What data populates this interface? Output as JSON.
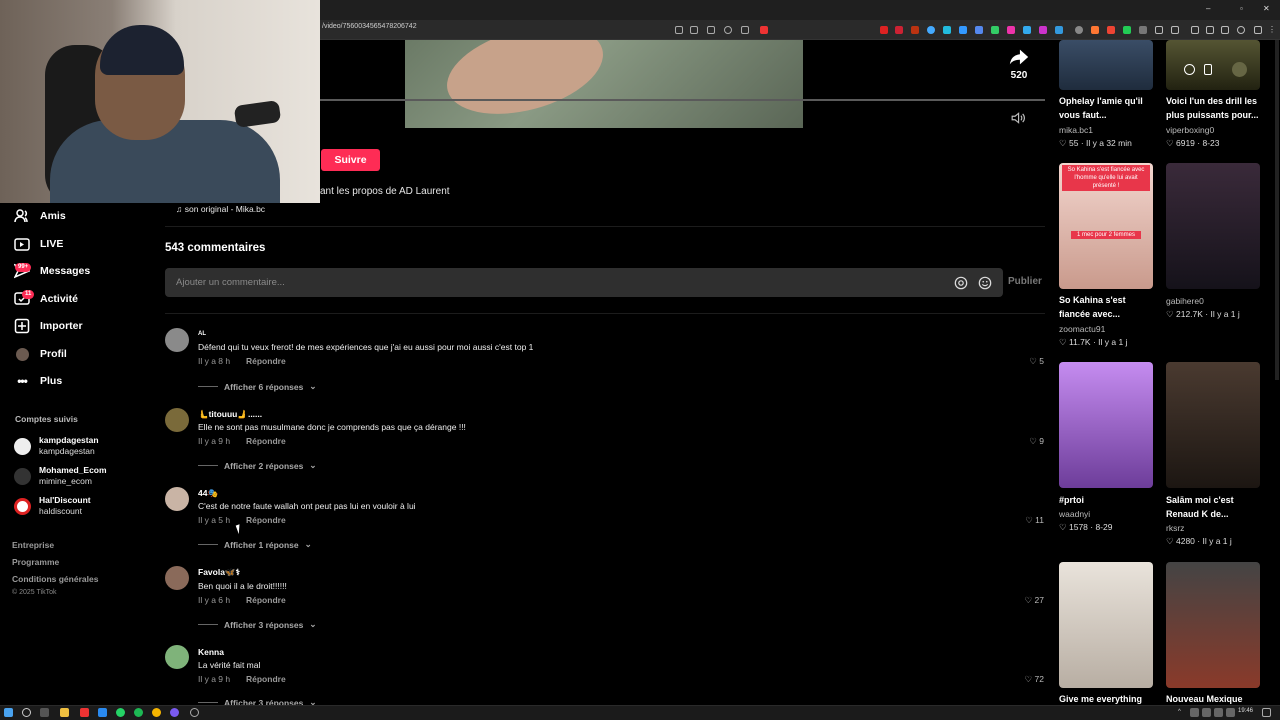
{
  "browser": {
    "url": "/video/7560034565478206742",
    "window_controls": [
      "–",
      "▫",
      "✕"
    ]
  },
  "video": {
    "share_count": "520"
  },
  "follow_label": "Suivre",
  "description_tail": "ant les propos de AD Laurent",
  "sound": "son original - Mika.bc",
  "sidebar": {
    "items": [
      {
        "label": "Amis",
        "icon": "friends-icon"
      },
      {
        "label": "LIVE",
        "icon": "live-icon"
      },
      {
        "label": "Messages",
        "icon": "messages-icon",
        "badge": "99+"
      },
      {
        "label": "Activité",
        "icon": "activity-icon",
        "badge": "11"
      },
      {
        "label": "Importer",
        "icon": "upload-icon"
      },
      {
        "label": "Profil",
        "icon": "profile-icon"
      },
      {
        "label": "Plus",
        "icon": "more-icon"
      }
    ],
    "followed_heading": "Comptes suivis",
    "followed": [
      {
        "name": "kampdagestan",
        "handle": "kampdagestan"
      },
      {
        "name": "Mohamed_Ecom",
        "handle": "mimine_ecom"
      },
      {
        "name": "Hal'Discount",
        "handle": "haldiscount"
      }
    ],
    "footer_links": [
      "Entreprise",
      "Programme",
      "Conditions générales"
    ],
    "copyright": "© 2025 TikTok"
  },
  "comments": {
    "count_label": "543 commentaires",
    "input_placeholder": "Ajouter un commentaire...",
    "post_label": "Publier",
    "reply_label": "Répondre",
    "items": [
      {
        "user": "AL",
        "text": "Défend qui tu veux frerot! de mes expériences que j'ai eu aussi pour moi aussi c'est top 1",
        "time": "Il y a 8 h",
        "likes": "5",
        "more": "Afficher 6 réponses"
      },
      {
        "user": "🫷titouuu🫸......",
        "text": "Elle ne sont pas musulmane donc je comprends pas que ça dérange !!!",
        "time": "Il y a 9 h",
        "likes": "9",
        "more": "Afficher 2 réponses"
      },
      {
        "user": "44🎭",
        "text": "C'est de notre faute wallah ont peut pas lui en vouloir à lui",
        "time": "Il y a 5 h",
        "likes": "11",
        "more": "Afficher 1 réponse"
      },
      {
        "user": "Favola🦋⚕",
        "text": "Ben quoi il a le droit!!!!!!",
        "time": "Il y a 6 h",
        "likes": "27",
        "more": "Afficher 3 réponses"
      },
      {
        "user": "Kenna",
        "text": "La vérité fait mal",
        "time": "Il y a 9 h",
        "likes": "72",
        "more": "Afficher 3 réponses"
      }
    ]
  },
  "related": [
    {
      "title": "Ophelay l'amie qu'il vous faut...",
      "author": "mika.bc1",
      "likes": "55",
      "age": "Il y a 32 min"
    },
    {
      "title": "Voici l'un des drill les plus puissants pour...",
      "author": "viperboxing0",
      "likes": "6919",
      "age": "8-23"
    },
    {
      "title": "So Kahina s'est fiancée avec...",
      "author": "zoomactu91",
      "likes": "11.7K",
      "age": "Il y a 1 j",
      "overlay": "So Kahina s'est fiancée avec l'homme qu'elle lui avait présenté !",
      "overlay2": "1 mec pour 2 femmes"
    },
    {
      "title": "",
      "author": "gabihere0",
      "likes": "212.7K",
      "age": "Il y a 1 j"
    },
    {
      "title": "#prtoi",
      "author": "waadnyi",
      "likes": "1578",
      "age": "8-29"
    },
    {
      "title": "Salām moi c'est Renaud K de...",
      "author": "rksrz",
      "likes": "4280",
      "age": "Il y a 1 j"
    },
    {
      "title": "Give me everything",
      "author": "",
      "likes": "",
      "age": ""
    },
    {
      "title": "Nouveau Mexique",
      "author": "",
      "likes": "",
      "age": ""
    }
  ],
  "taskbar": {
    "clock": "19:46"
  },
  "colors": {
    "accent": "#fe2c55",
    "background": "#000000",
    "input_bg": "#2f2f2f"
  }
}
